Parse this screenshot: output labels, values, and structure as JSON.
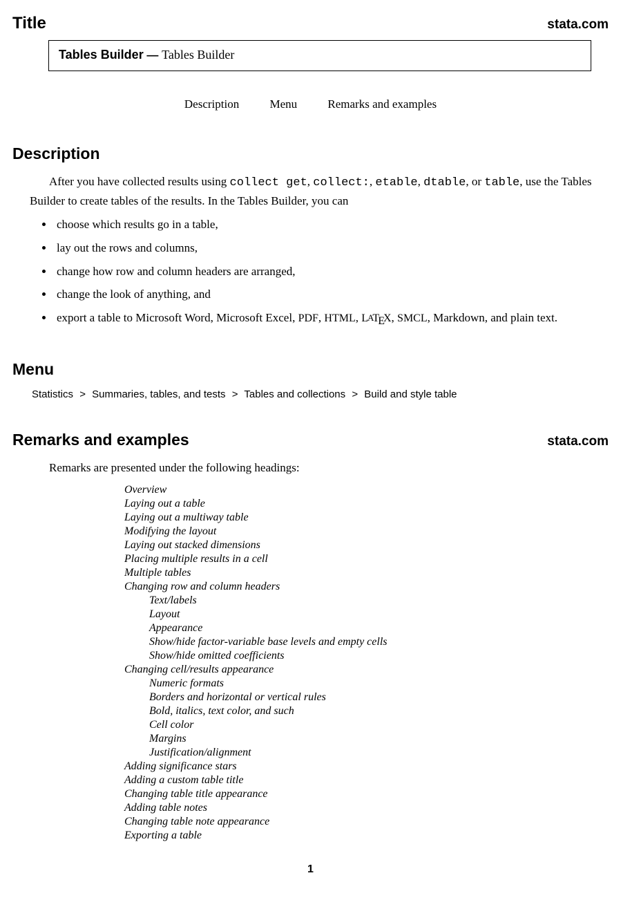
{
  "title_section": {
    "heading": "Title",
    "stata_link": "stata.com",
    "box_bold": "Tables Builder",
    "box_dash": " — ",
    "box_regular": "Tables Builder"
  },
  "nav": {
    "description": "Description",
    "menu": "Menu",
    "remarks": "Remarks and examples"
  },
  "description": {
    "heading": "Description",
    "para_before_cmds": "After you have collected results using ",
    "cmd1": "collect get",
    "cmd2": "collect:",
    "cmd3": "etable",
    "cmd4": "dtable",
    "cmd5": "table",
    "para_after_cmds": ", use the Tables Builder to create tables of the results. In the Tables Builder, you can",
    "bullets": [
      "choose which results go in a table,",
      "lay out the rows and columns,",
      "change how row and column headers are arranged,",
      "change the look of anything, and"
    ],
    "bullet5_prefix": "export a table to Microsoft Word, Microsoft Excel, ",
    "bullet5_pdf": "PDF",
    "bullet5_html": "HTML",
    "bullet5_smcl": "SMCL",
    "bullet5_suffix": ", Markdown, and plain text."
  },
  "menu": {
    "heading": "Menu",
    "path": [
      "Statistics",
      "Summaries, tables, and tests",
      "Tables and collections",
      "Build and style table"
    ]
  },
  "remarks": {
    "heading": "Remarks and examples",
    "stata_link": "stata.com",
    "intro": "Remarks are presented under the following headings:",
    "toc": [
      {
        "t": "Overview",
        "l": 0
      },
      {
        "t": "Laying out a table",
        "l": 0
      },
      {
        "t": "Laying out a multiway table",
        "l": 0
      },
      {
        "t": "Modifying the layout",
        "l": 0
      },
      {
        "t": "Laying out stacked dimensions",
        "l": 0
      },
      {
        "t": "Placing multiple results in a cell",
        "l": 0
      },
      {
        "t": "Multiple tables",
        "l": 0
      },
      {
        "t": "Changing row and column headers",
        "l": 0
      },
      {
        "t": "Text/labels",
        "l": 1
      },
      {
        "t": "Layout",
        "l": 1
      },
      {
        "t": "Appearance",
        "l": 1
      },
      {
        "t": "Show/hide factor-variable base levels and empty cells",
        "l": 1
      },
      {
        "t": "Show/hide omitted coefficients",
        "l": 1
      },
      {
        "t": "Changing cell/results appearance",
        "l": 0
      },
      {
        "t": "Numeric formats",
        "l": 1
      },
      {
        "t": "Borders and horizontal or vertical rules",
        "l": 1
      },
      {
        "t": "Bold, italics, text color, and such",
        "l": 1
      },
      {
        "t": "Cell color",
        "l": 1
      },
      {
        "t": "Margins",
        "l": 1
      },
      {
        "t": "Justification/alignment",
        "l": 1
      },
      {
        "t": "Adding significance stars",
        "l": 0
      },
      {
        "t": "Adding a custom table title",
        "l": 0
      },
      {
        "t": "Changing table title appearance",
        "l": 0
      },
      {
        "t": "Adding table notes",
        "l": 0
      },
      {
        "t": "Changing table note appearance",
        "l": 0
      },
      {
        "t": "Exporting a table",
        "l": 0
      }
    ]
  },
  "page_number": "1"
}
